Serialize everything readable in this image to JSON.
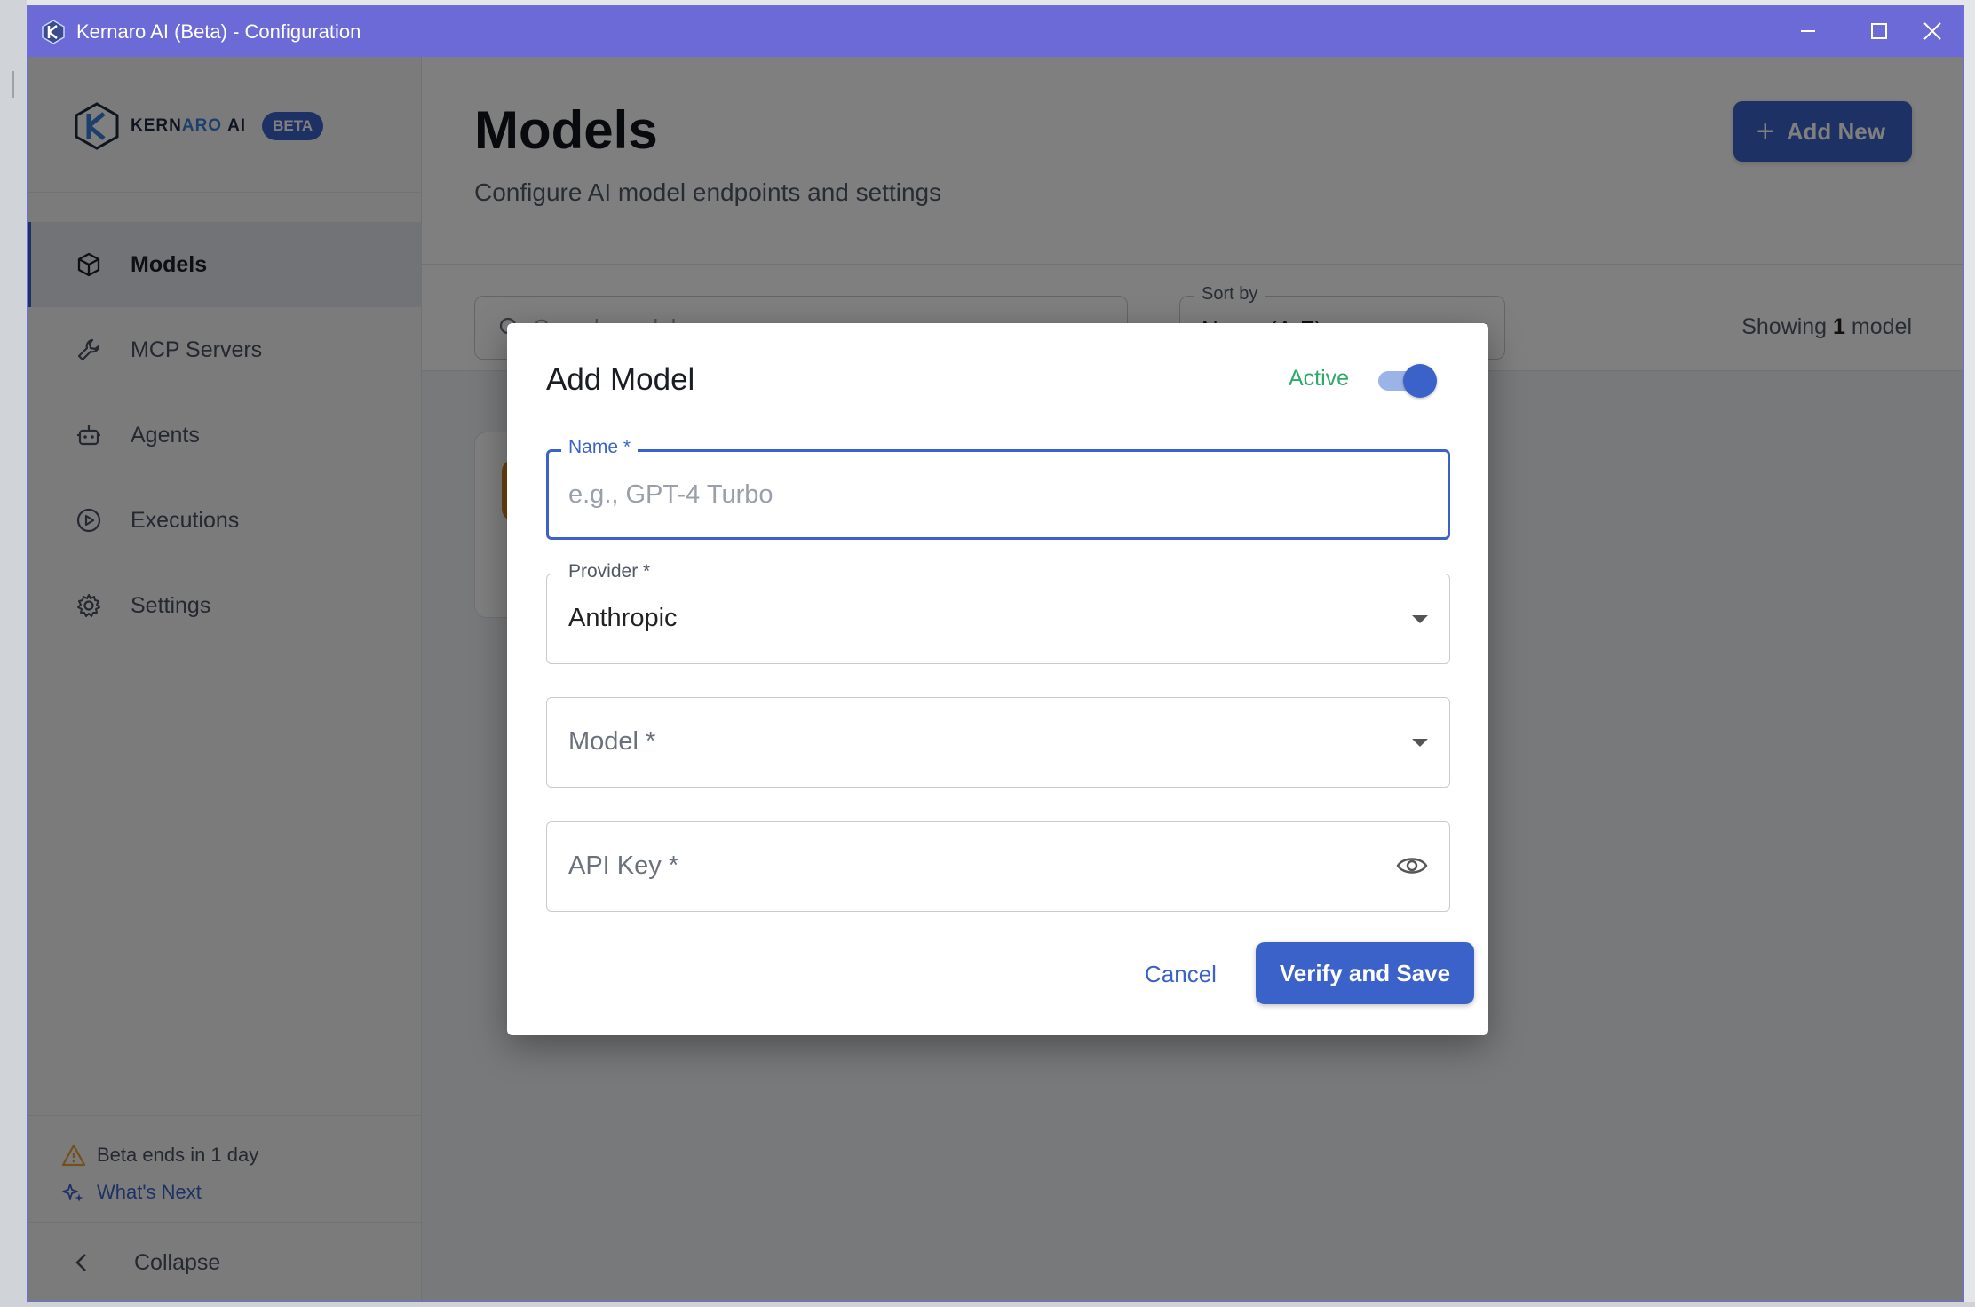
{
  "window": {
    "title": "Kernaro AI (Beta) - Configuration"
  },
  "sidebar": {
    "logo_text_a": "KERN",
    "logo_text_b": "ARO",
    "logo_text_c": "AI",
    "beta_badge": "BETA",
    "items": [
      {
        "label": "Models",
        "icon": "cube-icon",
        "active": true
      },
      {
        "label": "MCP Servers",
        "icon": "wrench-icon",
        "active": false
      },
      {
        "label": "Agents",
        "icon": "robot-icon",
        "active": false
      },
      {
        "label": "Executions",
        "icon": "play-circle-icon",
        "active": false
      },
      {
        "label": "Settings",
        "icon": "gear-icon",
        "active": false
      }
    ],
    "beta_notice": "Beta ends in 1 day",
    "whats_next": "What's Next",
    "collapse": "Collapse"
  },
  "main": {
    "title": "Models",
    "subtitle": "Configure AI model endpoints and settings",
    "add_new": "Add New",
    "search_placeholder": "Search models...",
    "sort_label": "Sort by",
    "sort_value": "Name (A-Z)",
    "showing_prefix": "Showing",
    "showing_count": "1",
    "showing_suffix": "model"
  },
  "dialog": {
    "title": "Add Model",
    "active_label": "Active",
    "active": true,
    "name_label": "Name *",
    "name_placeholder": "e.g., GPT-4 Turbo",
    "provider_label": "Provider *",
    "provider_value": "Anthropic",
    "model_placeholder": "Model *",
    "api_key_placeholder": "API Key *",
    "cancel": "Cancel",
    "verify_save": "Verify and Save"
  },
  "colors": {
    "titlebar": "#6b6ad6",
    "primary": "#3a62c8",
    "active_green": "#2eaa6a",
    "warning": "#e6a23c"
  }
}
